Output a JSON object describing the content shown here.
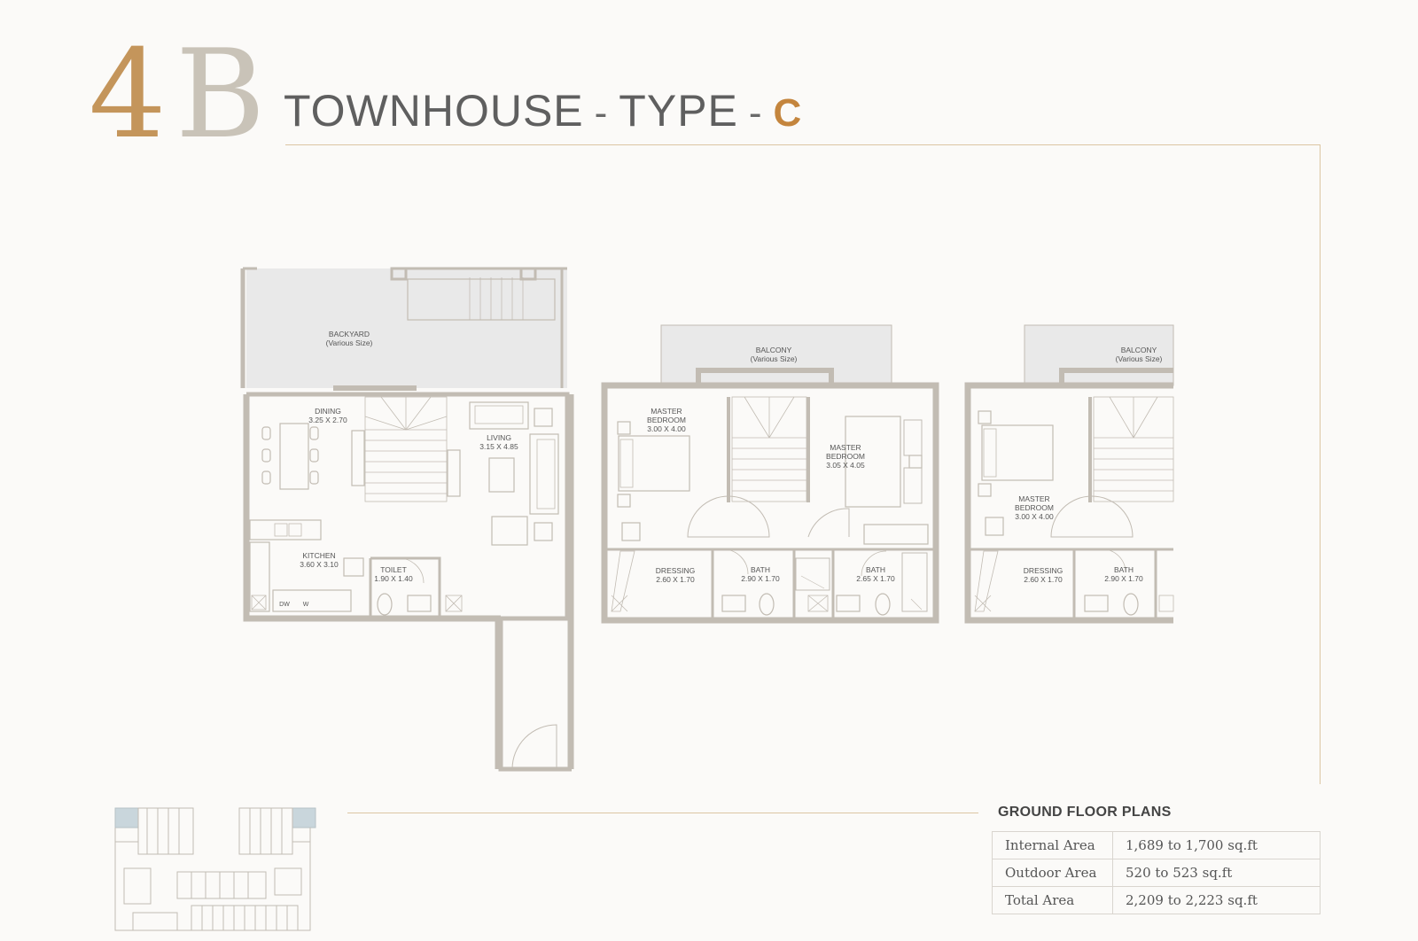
{
  "header": {
    "number": "4",
    "letter": "B",
    "title": "TOWNHOUSE",
    "separator": "-",
    "type_label": "TYPE",
    "type_letter": "C"
  },
  "colors": {
    "accent": "#c4955b",
    "muted_letter": "#c9c3b8",
    "rule": "#dcc6a3",
    "wall": "#c2bcb3",
    "outdoor_fill": "#e9e9e9"
  },
  "floorplans": {
    "ground": {
      "backyard": {
        "name": "BACKYARD",
        "size": "(Various Size)"
      },
      "dining": {
        "name": "DINING",
        "size": "3.25 X 2.70"
      },
      "living": {
        "name": "LIVING",
        "size": "3.15 X 4.85"
      },
      "kitchen": {
        "name": "KITCHEN",
        "size": "3.60 X 3.10"
      },
      "toilet": {
        "name": "TOILET",
        "size": "1.90 X 1.40"
      },
      "dw": "DW",
      "w": "W"
    },
    "first": {
      "balcony": {
        "name": "BALCONY",
        "size": "(Various Size)"
      },
      "master1_name": "MASTER",
      "master1": {
        "name": "BEDROOM",
        "size": "3.00 X 4.00"
      },
      "master2_name": "MASTER",
      "master2": {
        "name": "BEDROOM",
        "size": "3.05 X 4.05"
      },
      "dressing": {
        "name": "DRESSING",
        "size": "2.60 X 1.70"
      },
      "bath1": {
        "name": "BATH",
        "size": "2.90 X 1.70"
      },
      "bath2": {
        "name": "BATH",
        "size": "2.65 X 1.70"
      }
    },
    "second": {
      "balcony": {
        "name": "BALCONY",
        "size": "(Various Size)"
      },
      "master_name": "MASTER",
      "master": {
        "name": "BEDROOM",
        "size": "3.00 X 4.00"
      },
      "dressing": {
        "name": "DRESSING",
        "size": "2.60 X 1.70"
      },
      "bath": {
        "name": "BATH",
        "size": "2.90 X 1.70"
      }
    }
  },
  "areas": {
    "heading": "GROUND FLOOR PLANS",
    "rows": [
      {
        "label": "Internal Area",
        "value": "1,689 to 1,700 sq.ft"
      },
      {
        "label": "Outdoor Area",
        "value": "520 to 523 sq.ft"
      },
      {
        "label": "Total Area",
        "value": "2,209 to 2,223 sq.ft"
      }
    ]
  }
}
